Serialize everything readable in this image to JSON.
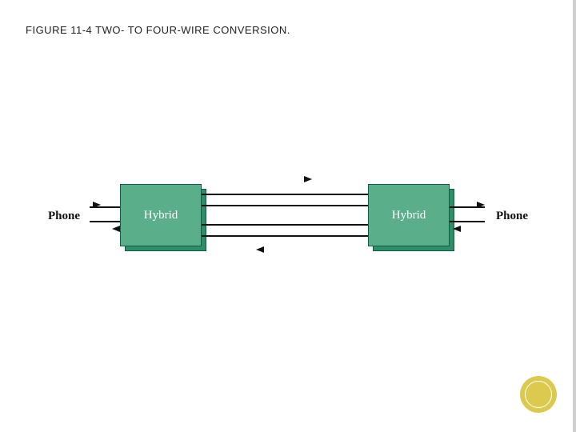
{
  "title_parts": {
    "prefix": "F",
    "rest": "IGURE 11-4 TWO- TO FOUR-WIRE CONVERSION."
  },
  "labels": {
    "phone_left": "Phone",
    "phone_right": "Phone",
    "hybrid_left": "Hybrid",
    "hybrid_right": "Hybrid"
  },
  "colors": {
    "block_front": "#5aae8a",
    "block_shadow": "#2f8d6a",
    "accent_circle": "#dcca4e"
  }
}
